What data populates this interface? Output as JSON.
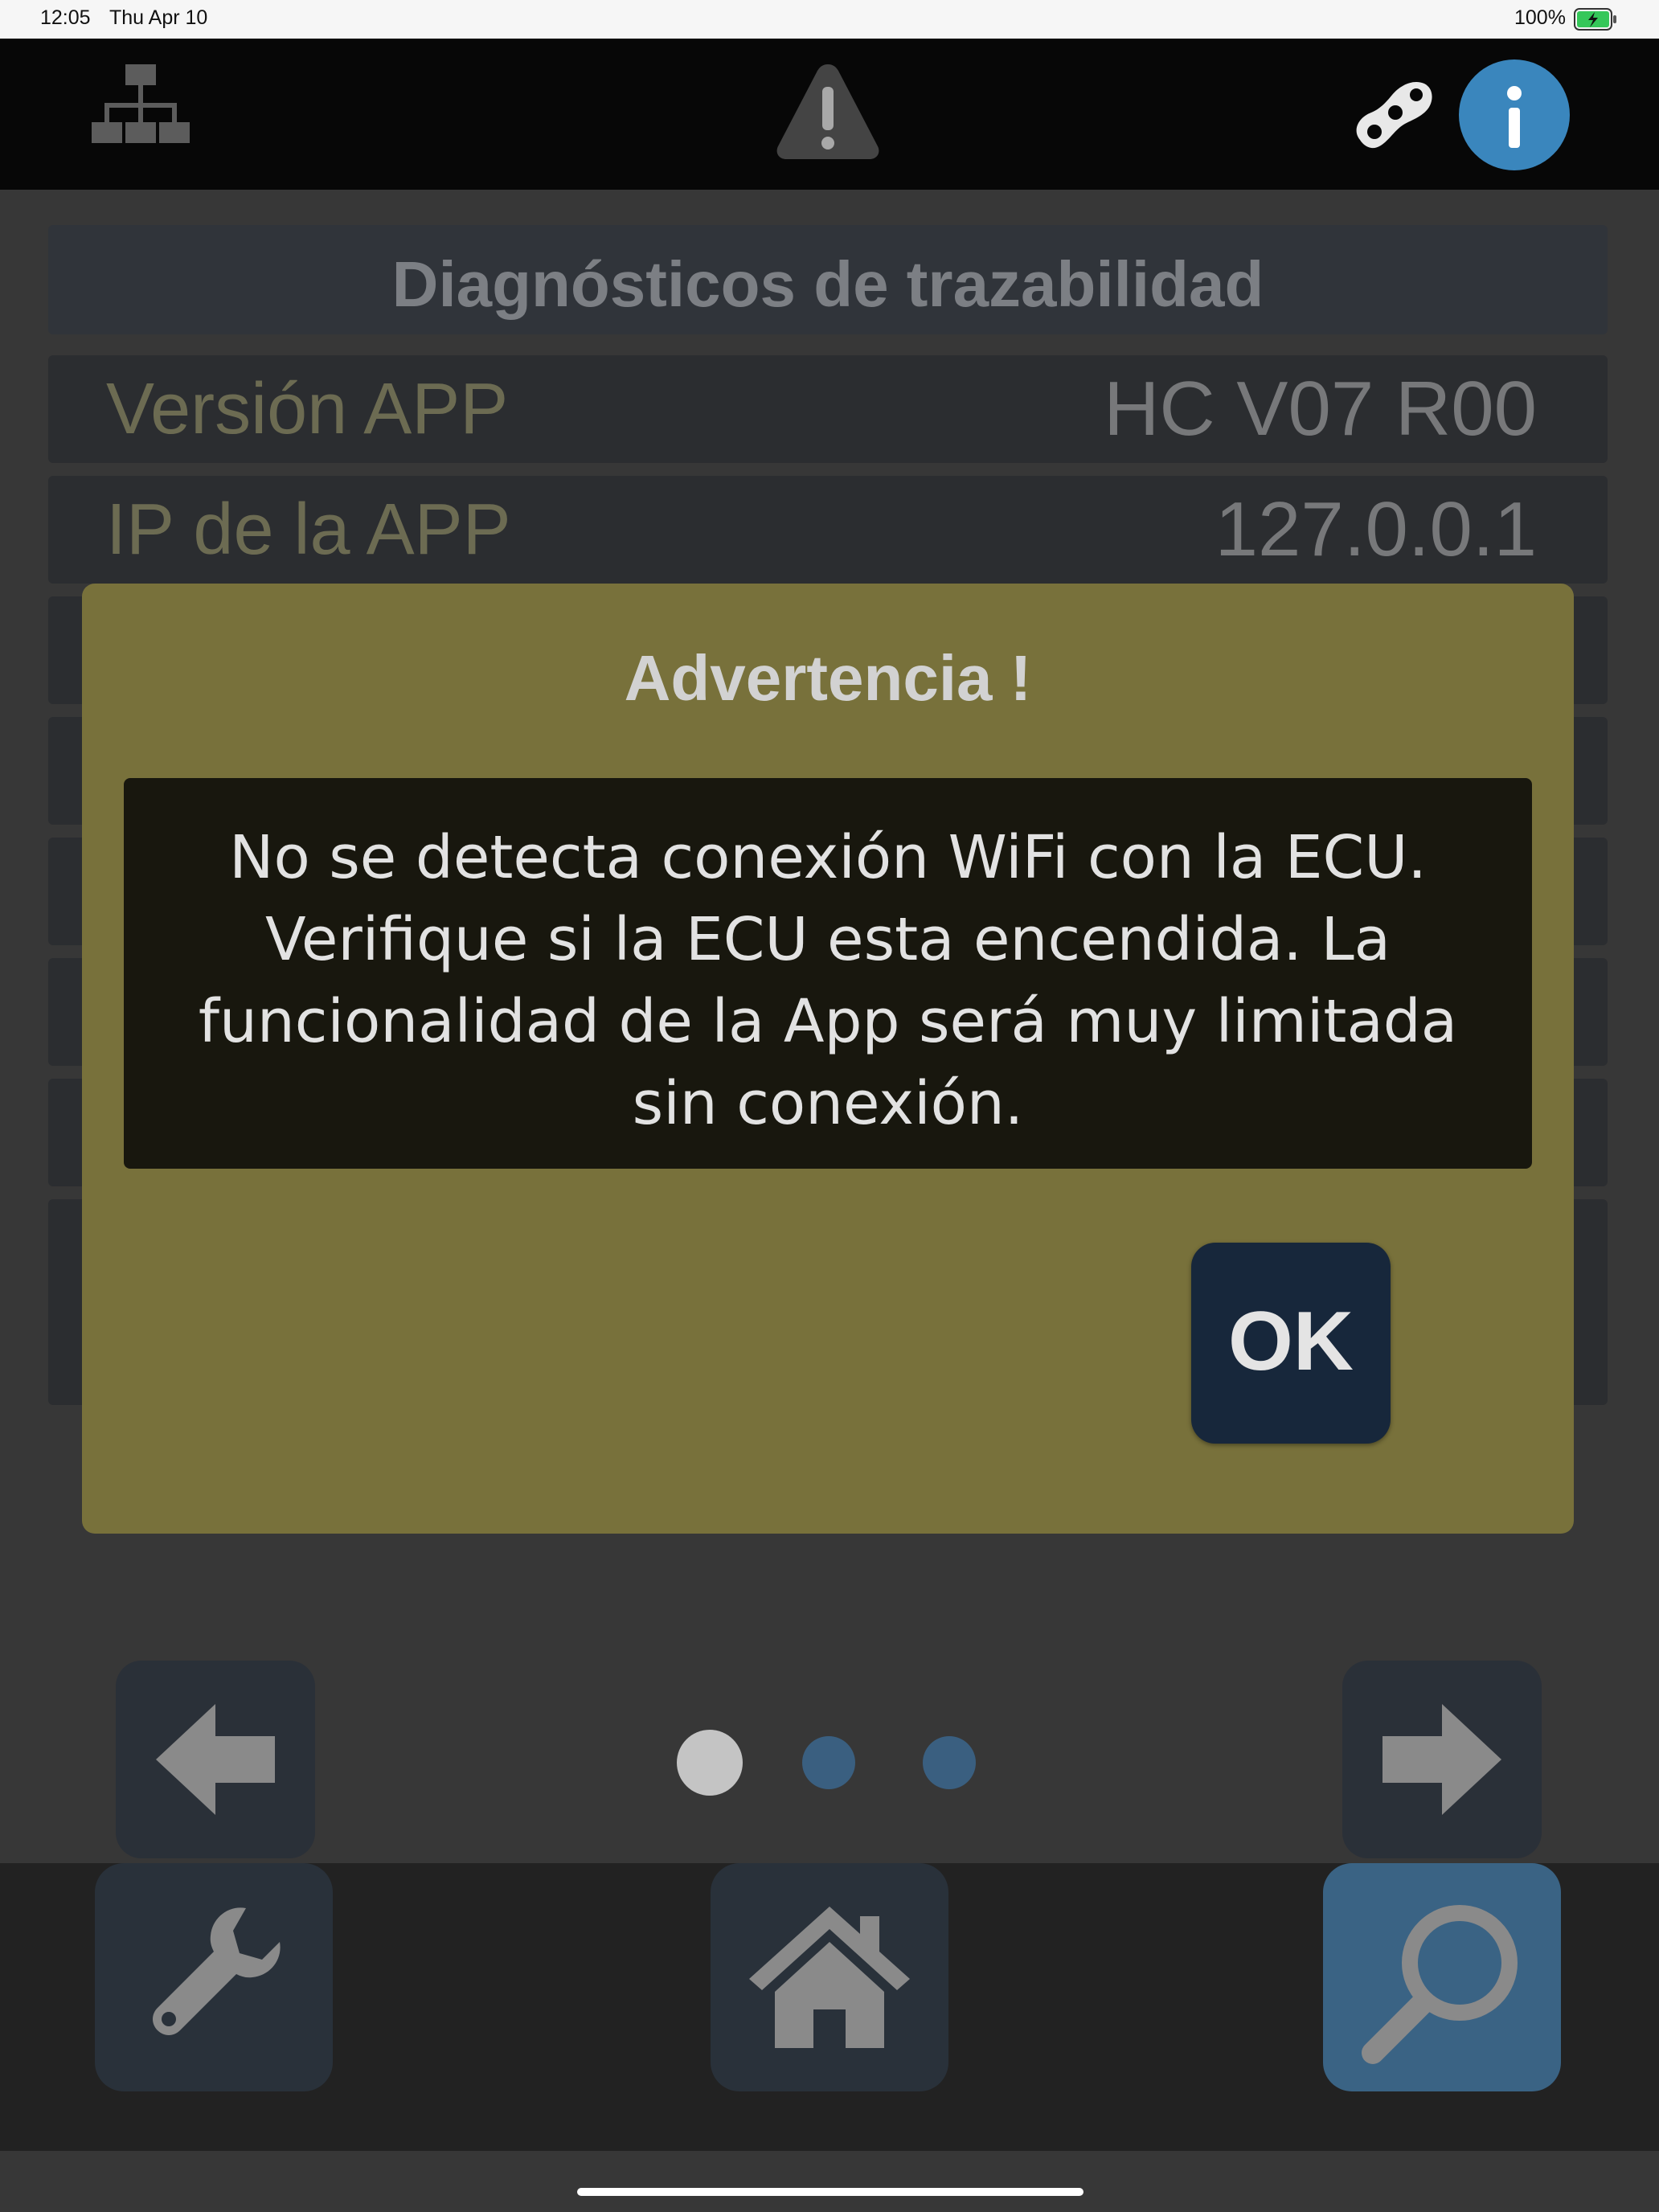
{
  "status_bar": {
    "time": "12:05",
    "date": "Thu Apr 10",
    "battery": "100%"
  },
  "toolbar": {
    "left_icon": "sitemap-icon",
    "center_icon": "warning-triangle-icon",
    "right_icons": [
      "soybean-icon",
      "info-icon"
    ],
    "info_color": "#3a86bd"
  },
  "header": {
    "title": "Diagnósticos de trazabilidad"
  },
  "rows": [
    {
      "label": "Versión APP",
      "value": "HC V07 R00"
    },
    {
      "label": "IP de la APP",
      "value": "127.0.0.1"
    }
  ],
  "dialog": {
    "title": "Advertencia !",
    "message": "No se detecta conexión WiFi con la ECU. Verifique si la ECU esta encendida. La funcionalidad de la App será muy limitada sin conexión.",
    "ok_label": "OK",
    "background": "#78713b"
  },
  "pager": {
    "pages": 3,
    "current": 1,
    "active_color": "#c4c4c4",
    "inactive_color": "#3a5f80"
  },
  "nav": {
    "back_icon": "arrow-left-icon",
    "forward_icon": "arrow-right-icon"
  },
  "bottom_tabs": [
    {
      "icon": "wrench-icon",
      "selected": false
    },
    {
      "icon": "home-icon",
      "selected": false
    },
    {
      "icon": "magnifier-icon",
      "selected": true
    }
  ]
}
